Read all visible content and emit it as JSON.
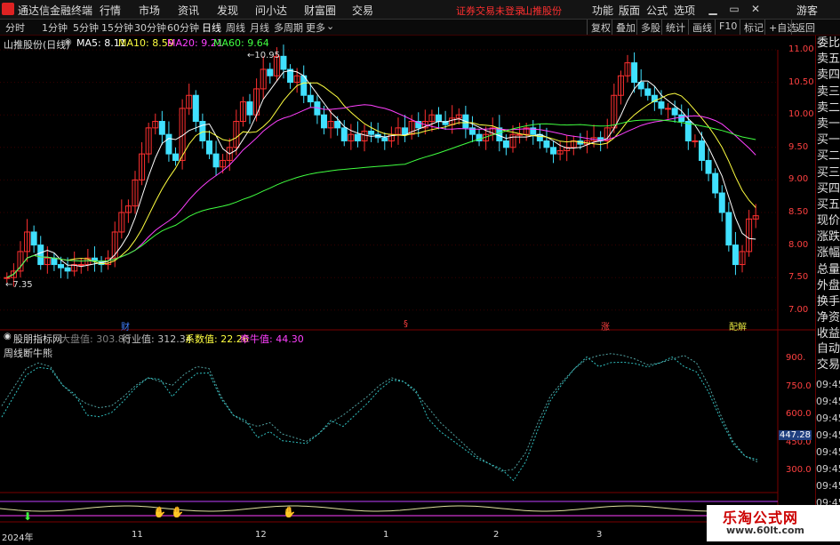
{
  "titlebar": {
    "app_name": "通达信金融终端",
    "menus": [
      "行情",
      "市场",
      "资讯",
      "发现",
      "问小达",
      "财富圈",
      "交易"
    ],
    "notice_login": "证券交易未登录",
    "notice_stock": "山推股份",
    "right_menus": [
      "功能",
      "版面",
      "公式",
      "选项"
    ],
    "guest": "游客",
    "icons": [
      "minimize-icon",
      "restore-icon",
      "close-icon"
    ]
  },
  "toolbar": {
    "periods": [
      "分时",
      "1分钟",
      "5分钟",
      "15分钟",
      "30分钟",
      "60分钟",
      "日线",
      "周线",
      "月线",
      "多周期",
      "更多"
    ],
    "active_period": "日线",
    "right_buttons": [
      "复权",
      "叠加",
      "多股",
      "统计",
      "画线",
      "F10",
      "标记",
      "+自选",
      "返回"
    ]
  },
  "main_chart": {
    "stock_label": "山推股份(日线)",
    "ma_labels": [
      {
        "text": "MA5: 8.11",
        "color": "#ffffff"
      },
      {
        "text": "MA10: 8.59",
        "color": "#ffff40"
      },
      {
        "text": "MA20: 9.21",
        "color": "#ff40ff"
      },
      {
        "text": "MA60: 9.64",
        "color": "#40ff40"
      }
    ],
    "high_marker": "10.95",
    "low_marker": "7.35",
    "price_ticks": [
      "11.00",
      "10.50",
      "10.00",
      "9.50",
      "9.00",
      "8.50",
      "8.00",
      "7.50",
      "7.00"
    ],
    "event_markers": [
      {
        "text": "财",
        "color": "#4080ff"
      },
      {
        "text": "§",
        "color": "#ff4040"
      },
      {
        "text": "涨",
        "color": "#ff4040"
      },
      {
        "text": "配解",
        "color": "#e0e040"
      }
    ]
  },
  "indicator": {
    "name": "股朋指标网",
    "values": [
      {
        "label": "大盘值: ",
        "value": "303.88",
        "color": "#808080"
      },
      {
        "label": "行业值: ",
        "value": "312.34",
        "color": "#c0c0c0"
      },
      {
        "label": "系数值: ",
        "value": "22.26",
        "color": "#ffff40"
      },
      {
        "label": "牵牛值: ",
        "value": "44.30",
        "color": "#ff40ff"
      }
    ],
    "subtitle": "周线断牛熊",
    "ticks": [
      "900.",
      "750.0",
      "600.0",
      "450.0",
      "300.0"
    ],
    "current_value": "447.28"
  },
  "x_axis": [
    "2024年",
    "11",
    "12",
    "1",
    "2",
    "3"
  ],
  "sidebar": {
    "items": [
      "委比",
      "卖五",
      "卖四",
      "卖三",
      "卖二",
      "卖一",
      "买一",
      "买二",
      "买三",
      "买四",
      "买五",
      "现价",
      "涨跌",
      "涨幅",
      "总量",
      "外盘",
      "换手",
      "净资",
      "收益"
    ],
    "lower": [
      "自动",
      "交易"
    ],
    "times": [
      "09:45",
      "09:45",
      "09:45",
      "09:45",
      "09:45",
      "09:45",
      "09:45",
      "09:45",
      "09:45",
      "09:45"
    ]
  },
  "watermark": {
    "line1": "乐淘公式网",
    "line2": "www.60lt.com"
  }
}
